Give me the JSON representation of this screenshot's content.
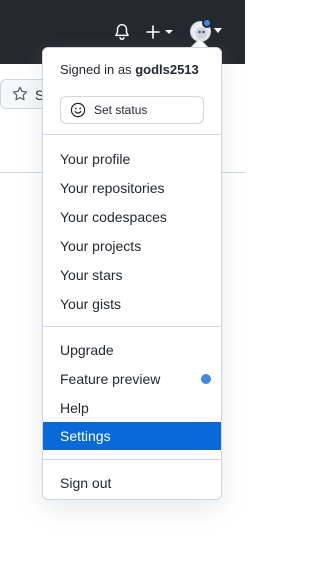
{
  "header": {
    "bell_icon": "bell-icon",
    "create_icon": "plus-icon",
    "avatar_icon": "avatar-icon"
  },
  "background": {
    "star_icon": "star-icon",
    "star_label_visible": "S"
  },
  "menu": {
    "signed_in_prefix": "Signed in as",
    "username": "godls2513",
    "set_status_label": "Set status",
    "profile_items": [
      "Your profile",
      "Your repositories",
      "Your codespaces",
      "Your projects",
      "Your stars",
      "Your gists"
    ],
    "extra_items": [
      "Upgrade",
      "Feature preview",
      "Help",
      "Settings"
    ],
    "sign_out": "Sign out",
    "active_item": "Settings"
  },
  "colors": {
    "header_bg": "#24292f",
    "active_bg": "#0969da",
    "indicator_blue": "#3d87e6"
  }
}
